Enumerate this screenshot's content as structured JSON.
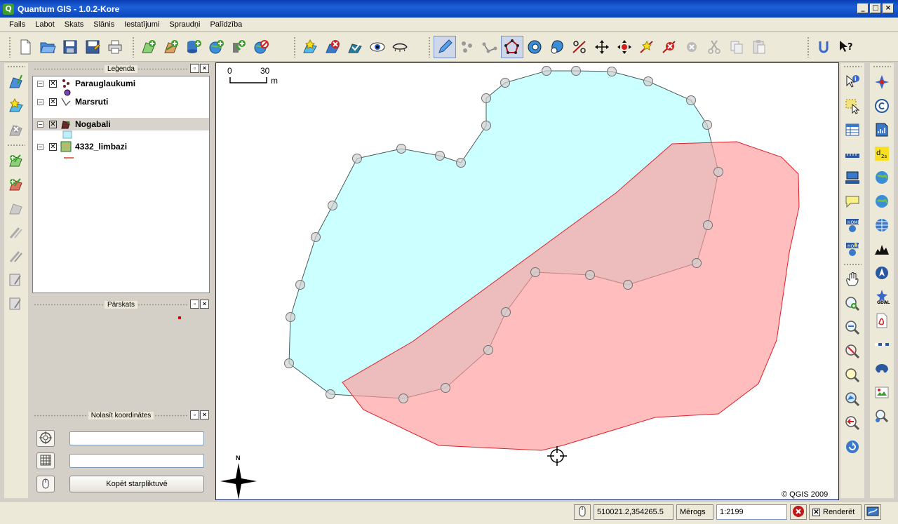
{
  "window": {
    "title": "Quantum GIS - 1.0.2-Kore",
    "app_icon_letter": "Q",
    "minimize": "_",
    "restore": "□",
    "close": "×"
  },
  "menu": [
    "Fails",
    "Labot",
    "Skats",
    "Slānis",
    "Iestatījumi",
    "Spraudņi",
    "Palīdzība"
  ],
  "toolbar_icons": {
    "file": [
      "new-project-icon",
      "open-project-icon",
      "save-project-icon",
      "save-as-icon",
      "print-icon"
    ],
    "layers": [
      "add-vector-layer-icon",
      "add-raster-layer-icon",
      "add-postgis-layer-icon",
      "add-wms-layer-icon",
      "add-spatialite-icon",
      "remove-layer-icon"
    ],
    "view": [
      "add-to-overview-icon",
      "remove-from-overview-icon",
      "show-all-icon",
      "show-layers-icon",
      "hide-layers-icon"
    ],
    "edit": [
      "toggle-editing-icon",
      "capture-point-icon",
      "capture-line-icon",
      "capture-polygon-icon",
      "add-ring-icon",
      "add-island-icon",
      "split-features-icon",
      "move-feature-icon",
      "move-vertex-icon",
      "add-vertex-icon",
      "delete-vertex-icon",
      "delete-selected-icon",
      "cut-features-icon",
      "copy-features-icon",
      "paste-features-icon"
    ],
    "help": [
      "plugin-manager-icon",
      "whats-this-icon"
    ]
  },
  "legend": {
    "title": "Leģenda",
    "layers": [
      {
        "name": "Parauglaukumi",
        "checked": "✕",
        "selected": false
      },
      {
        "name": "Marsruti",
        "checked": "✕",
        "selected": false
      },
      {
        "name": "Nogabali",
        "checked": "✕",
        "selected": true
      },
      {
        "name": "4332_limbazi",
        "checked": "✕",
        "selected": false
      }
    ]
  },
  "overview": {
    "title": "Pārskats"
  },
  "coords_panel": {
    "title": "Nolasīt koordinātes",
    "copy_button": "Kopēt starpliktuvē",
    "field1": "",
    "field2": ""
  },
  "map": {
    "scale_start": "0",
    "scale_end": "30",
    "scale_unit": "m",
    "north_label": "N",
    "copyright": "© QGIS 2009",
    "colors": {
      "cyan_fill": "#ccffff",
      "red_fill": "#ffbbbb",
      "red_stroke": "#e0202a",
      "cyan_stroke": "#4a5a5a"
    }
  },
  "status": {
    "coordinates": "510021.2,354265.5",
    "scale_label": "Mērogs",
    "scale_value": "1:2199",
    "render_label": "Renderēt",
    "render_checked": "✕"
  }
}
